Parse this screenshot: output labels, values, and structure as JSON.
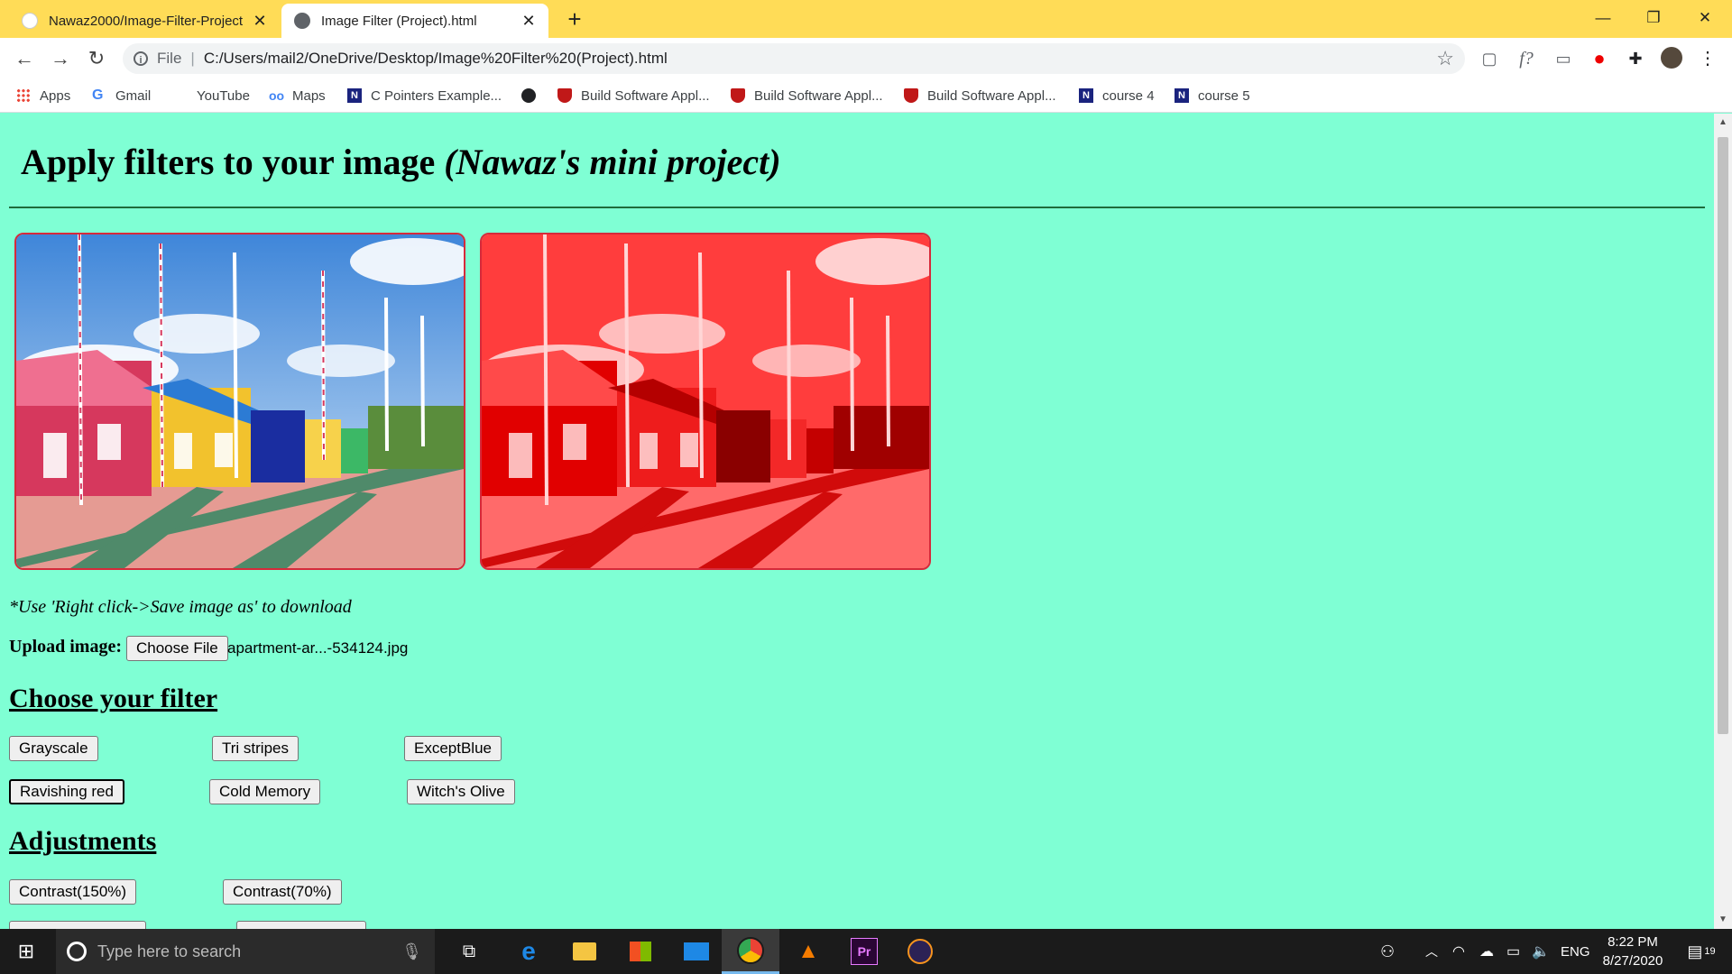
{
  "browser": {
    "tabs": [
      {
        "title": "Nawaz2000/Image-Filter-Project",
        "favicon": "github-icon"
      },
      {
        "title": "Image Filter (Project).html",
        "favicon": "globe-icon"
      }
    ],
    "new_tab_glyph": "+",
    "window_controls": {
      "minimize": "—",
      "maximize": "❐",
      "close": "✕"
    },
    "nav": {
      "back": "←",
      "forward": "→",
      "reload": "↻"
    },
    "address": {
      "scheme": "File",
      "separator": "|",
      "url": "C:/Users/mail2/OneDrive/Desktop/Image%20Filter%20(Project).html"
    },
    "bookmarks": [
      {
        "label": "Apps",
        "icon": "apps-grid-icon",
        "color": "#4285f4"
      },
      {
        "label": "Gmail",
        "icon": "google-icon",
        "color": "#4285f4"
      },
      {
        "label": "YouTube",
        "icon": "youtube-icon",
        "color": "#ff0000"
      },
      {
        "label": "Maps",
        "icon": "maps-icon",
        "color": "#4285f4"
      },
      {
        "label": "C Pointers Example...",
        "icon": "bookmark-n-icon",
        "color": "#1a237e"
      },
      {
        "label": "",
        "icon": "globe-icon",
        "color": "#202124"
      },
      {
        "label": "Build Software Appl...",
        "icon": "mcafee-shield-icon",
        "color": "#c01818"
      },
      {
        "label": "Build Software Appl...",
        "icon": "mcafee-shield-icon",
        "color": "#c01818"
      },
      {
        "label": "Build Software Appl...",
        "icon": "mcafee-shield-icon",
        "color": "#c01818"
      },
      {
        "label": "course 4",
        "icon": "bookmark-n-icon",
        "color": "#1a237e"
      },
      {
        "label": "course 5",
        "icon": "bookmark-n-icon",
        "color": "#1a237e"
      }
    ]
  },
  "page": {
    "title_main": "Apply filters to your image ",
    "title_em": "(Nawaz's mini project)",
    "note": "*Use 'Right click->Save image as' to download",
    "upload_label": "Upload image:",
    "choose_file": "Choose File",
    "file_name": "apartment-ar...-534124.jpg",
    "filter_heading": "Choose your filter",
    "filters": [
      "Grayscale",
      "Tri stripes",
      "ExceptBlue",
      "Ravishing red",
      "Cold Memory",
      "Witch's Olive"
    ],
    "adjust_heading": "Adjustments",
    "adjustments": [
      "Contrast(150%)",
      "Contrast(70%)"
    ],
    "accent_color": "#7fffd4"
  },
  "taskbar": {
    "search_placeholder": "Type here to search",
    "language": "ENG",
    "time": "8:22 PM",
    "date": "8/27/2020",
    "notification_count": "19"
  }
}
